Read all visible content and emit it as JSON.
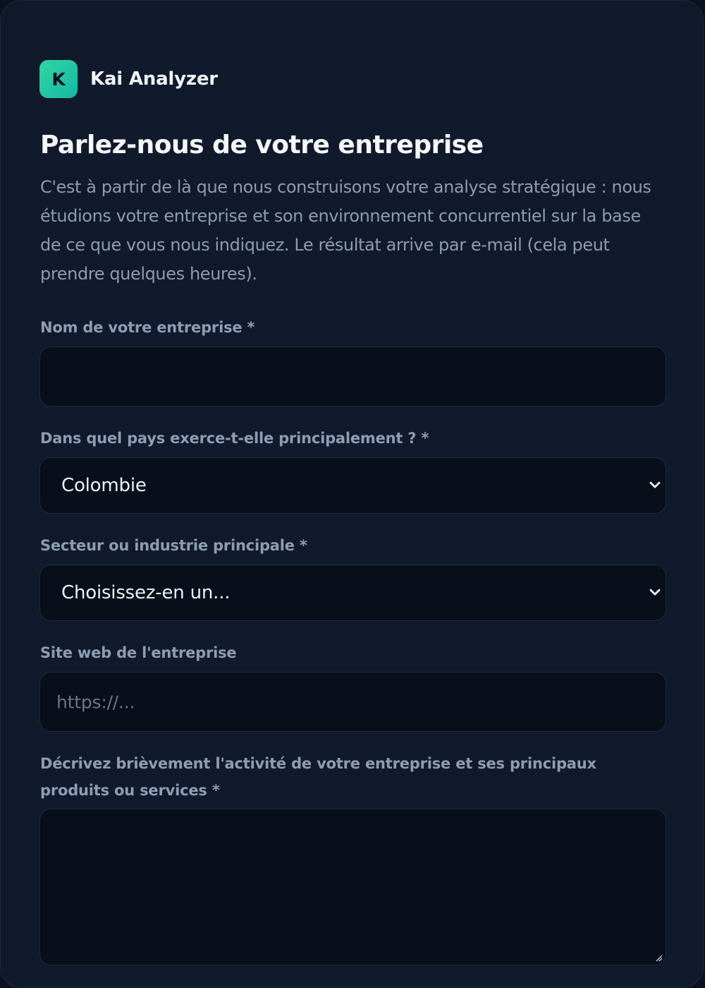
{
  "brand": {
    "logo_letter": "K",
    "name": "Kai Analyzer"
  },
  "heading": {
    "title": "Parlez-nous de votre entreprise",
    "intro": "C'est à partir de là que nous construisons votre analyse stratégique : nous étudions votre entreprise et son environnement concurrentiel sur la base de ce que vous nous indiquez. Le résultat arrive par e-mail (cela peut prendre quelques heures)."
  },
  "form": {
    "company_name": {
      "label": "Nom de votre entreprise *",
      "value": ""
    },
    "country": {
      "label": "Dans quel pays exerce-t-elle principalement ? *",
      "selected": "Colombie"
    },
    "sector": {
      "label": "Secteur ou industrie principale *",
      "selected": "Choisissez-en un..."
    },
    "website": {
      "label": "Site web de l'entreprise",
      "placeholder": "https://..."
    },
    "description": {
      "label": "Décrivez brièvement l'activité de votre entreprise et ses principaux produits ou services *",
      "value": ""
    }
  },
  "icons": {
    "select_arrow": "chevron-down-icon",
    "textarea_resize": "resize-handle-icon"
  },
  "colors": {
    "background": "#101a2c",
    "field_background": "#080e1a",
    "accent": "#2fd6a3",
    "title": "#f5f7fb",
    "muted_text": "#8d9bb3"
  }
}
